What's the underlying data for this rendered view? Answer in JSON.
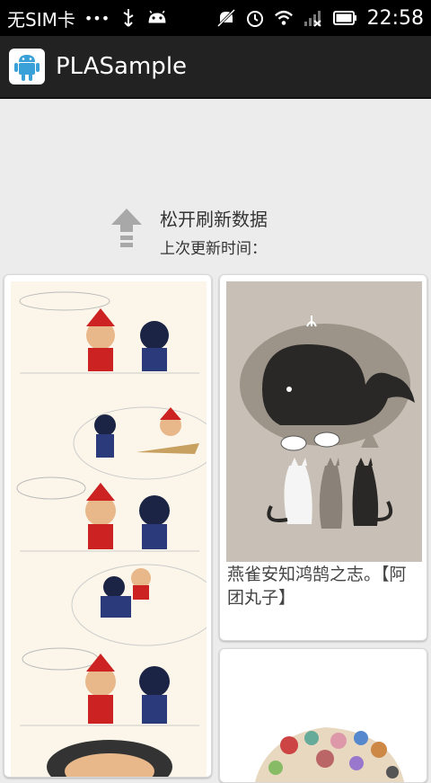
{
  "status_bar": {
    "carrier": "无SIM卡",
    "dots": "•••",
    "time": "22:58",
    "icons": [
      "usb-icon",
      "android-icon",
      "mute-icon",
      "alarm-icon",
      "wifi-icon",
      "signal-icon",
      "battery-icon"
    ]
  },
  "action_bar": {
    "title": "PLASample",
    "icon": "android-app-icon"
  },
  "refresh_header": {
    "primary": "松开刷新数据",
    "secondary": "上次更新时间："
  },
  "cards": [
    {
      "image": "comic-strip-image",
      "caption": ""
    },
    {
      "image": "cats-whale-image",
      "caption": "燕雀安知鸿鹄之志。【阿团丸子】"
    },
    {
      "image": "collage-image",
      "caption": ""
    }
  ],
  "colors": {
    "status_bar": "#000000",
    "action_bar": "#222222",
    "background": "#ececec",
    "accent": "#3aa0d8"
  }
}
